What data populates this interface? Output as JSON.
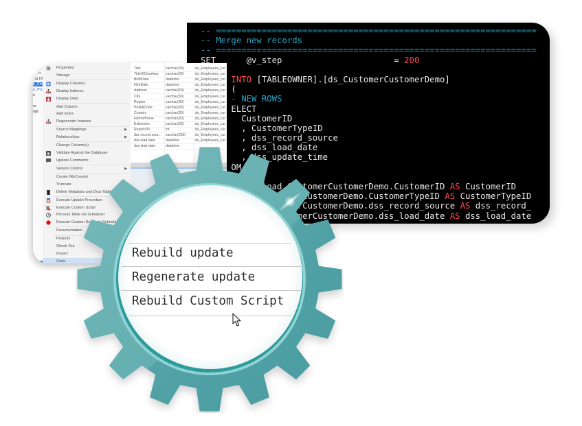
{
  "code_window": {
    "lines": [
      [
        {
          "t": "-- ===============================================================",
          "c": "comment"
        }
      ],
      [
        {
          "t": "-- Merge new records",
          "c": "comment"
        }
      ],
      [
        {
          "t": "-- ===============================================================",
          "c": "comment"
        }
      ],
      [
        {
          "t": "SET      @v_step                      = ",
          "c": "plain"
        },
        {
          "t": "200",
          "c": "num"
        }
      ],
      [
        {
          "t": "",
          "c": "plain"
        }
      ],
      [
        {
          "t": "      ",
          "c": "plain"
        },
        {
          "t": "INTO",
          "c": "kw"
        },
        {
          "t": " [TABLEOWNER].[ds_CustomerCustomerDemo]",
          "c": "plain"
        }
      ],
      [
        {
          "t": "      (",
          "c": "plain"
        }
      ],
      [
        {
          "t": "      ",
          "c": "plain"
        },
        {
          "t": "- NEW ROWS",
          "c": "comment"
        }
      ],
      [
        {
          "t": "      ELECT",
          "c": "plain"
        }
      ],
      [
        {
          "t": "        CustomerID",
          "c": "plain"
        }
      ],
      [
        {
          "t": "        , CustomerTypeID",
          "c": "plain"
        }
      ],
      [
        {
          "t": "        , dss_record_source",
          "c": "plain"
        }
      ],
      [
        {
          "t": "        , dss_load_date",
          "c": "plain"
        }
      ],
      [
        {
          "t": "        , dss_update_time",
          "c": "plain"
        }
      ],
      [
        {
          "t": "      OM",
          "c": "plain"
        }
      ],
      [
        {
          "t": "        (",
          "c": "plain"
        }
      ],
      [
        {
          "t": "            load_CustomerCustomerDemo.CustomerID ",
          "c": "plain"
        },
        {
          "t": "AS",
          "c": "kw"
        },
        {
          "t": " CustomerID",
          "c": "plain"
        }
      ],
      [
        {
          "t": "           _CustomerCustomerDemo.CustomerTypeID ",
          "c": "plain"
        },
        {
          "t": "AS",
          "c": "kw"
        },
        {
          "t": " CustomerTypeID",
          "c": "plain"
        }
      ],
      [
        {
          "t": "            CustomerCustomerDemo.dss_record_source ",
          "c": "plain"
        },
        {
          "t": "AS",
          "c": "kw"
        },
        {
          "t": " dss_record_",
          "c": "plain"
        }
      ],
      [
        {
          "t": "            erCustomerCustomerDemo.dss_load_date ",
          "c": "plain"
        },
        {
          "t": "AS",
          "c": "kw"
        },
        {
          "t": " dss_load_date",
          "c": "plain"
        }
      ]
    ]
  },
  "tree": {
    "items": [
      {
        "label": "ision",
        "style": ""
      },
      {
        "label": "ing Di",
        "style": ""
      },
      {
        "label": "n_Emp",
        "style": "sel"
      },
      {
        "label": "n_Prod",
        "style": "link"
      },
      {
        "label": "e",
        "style": ""
      },
      {
        "label": "",
        "style": ""
      },
      {
        "label": "re",
        "style": ""
      },
      {
        "label": "ript",
        "style": ""
      }
    ]
  },
  "context_menu": {
    "items": [
      {
        "label": "Properties",
        "icon": "gear-icon",
        "submenu": false
      },
      {
        "label": "Storage",
        "icon": "",
        "submenu": false
      },
      {
        "sep": true
      },
      {
        "label": "Display Columns",
        "icon": "columns-icon",
        "submenu": false
      },
      {
        "label": "Display Indexes",
        "icon": "indexes-icon",
        "submenu": false
      },
      {
        "label": "Display Data",
        "icon": "data-chart-icon",
        "submenu": false
      },
      {
        "sep": true
      },
      {
        "label": "Add Column",
        "icon": "",
        "submenu": false
      },
      {
        "label": "Add Index",
        "icon": "",
        "submenu": false
      },
      {
        "label": "Regenerate Indexes",
        "icon": "indexes-icon",
        "submenu": false
      },
      {
        "sep": true
      },
      {
        "label": "Source Mappings",
        "icon": "",
        "submenu": true
      },
      {
        "label": "Relationships",
        "icon": "",
        "submenu": true
      },
      {
        "sep": true
      },
      {
        "label": "Change Column(s)",
        "icon": "",
        "submenu": false
      },
      {
        "label": "Validate Against the Database",
        "icon": "validate-icon",
        "submenu": false
      },
      {
        "label": "Update Comments",
        "icon": "comment-icon",
        "submenu": false
      },
      {
        "sep": true
      },
      {
        "label": "Version Control",
        "icon": "",
        "submenu": true
      },
      {
        "sep": true
      },
      {
        "label": "Create (ReCreate)",
        "icon": "",
        "submenu": false
      },
      {
        "label": "Truncate",
        "icon": "",
        "submenu": false
      },
      {
        "label": "Delete Metadata and Drop Table",
        "icon": "delete-icon",
        "submenu": false
      },
      {
        "sep": true
      },
      {
        "label": "Execute Update Procedure",
        "icon": "execute-update-icon",
        "submenu": false
      },
      {
        "label": "Execute Custom Script",
        "icon": "execute-script-icon",
        "submenu": false
      },
      {
        "label": "Process Table via Scheduler",
        "icon": "clock-icon",
        "submenu": false
      },
      {
        "label": "Execute Custom Script via Scheduler",
        "icon": "red-circle-icon",
        "submenu": false
      },
      {
        "sep": true
      },
      {
        "label": "Documentation",
        "icon": "",
        "submenu": false
      },
      {
        "sep": true
      },
      {
        "label": "Projects",
        "icon": "",
        "submenu": false
      },
      {
        "label": "Check Out",
        "icon": "",
        "submenu": false
      },
      {
        "label": "Impact",
        "icon": "",
        "submenu": false
      },
      {
        "label": "Code",
        "icon": "",
        "submenu": false,
        "highlight": true
      }
    ]
  },
  "columns_grid": {
    "rows": [
      [
        "Title",
        "varchar(30)",
        "ds_Employees_cur"
      ],
      [
        "TitleOfCourtesy",
        "varchar(30)",
        "ds_Employees_cur"
      ],
      [
        "BirthDate",
        "datetime",
        "ds_Employees_cur"
      ],
      [
        "HireDate",
        "datetime",
        "ds_Employees_cur"
      ],
      [
        "Address",
        "varchar(60)",
        "ds_Employees_cur"
      ],
      [
        "City",
        "varchar(30)",
        "ds_Employees_cur"
      ],
      [
        "Region",
        "varchar(30)",
        "ds_Employees_cur"
      ],
      [
        "PostalCode",
        "varchar(30)",
        "ds_Employees_cur"
      ],
      [
        "Country",
        "varchar(30)",
        "ds_Employees_cur"
      ],
      [
        "HomePhone",
        "varchar(30)",
        "ds_Employees_cur"
      ],
      [
        "Extension",
        "varchar(30)",
        "ds_Employees_cur"
      ],
      [
        "ReportsTo",
        "int",
        "ds_Employees_cur"
      ],
      [
        "dss record sour...",
        "varchar(255)",
        "ds_Employees_cur"
      ],
      [
        "dss load date",
        "datetime",
        "ds_Employees_cur"
      ],
      [
        "dss start date",
        "datetime",
        ""
      ]
    ]
  },
  "lens_menu": {
    "items": [
      "Rebuild update",
      "Regenerate update",
      "Rebuild Custom Script"
    ]
  },
  "colors": {
    "gear": "#55a8ab",
    "gear_light": "#74b7b9",
    "gear_ring": "#8fd3d3",
    "code_bg": "#000000",
    "code_comment": "#2aa3c4",
    "code_keyword": "#ff4a4a",
    "menu_highlight": "#cfe0f4",
    "selection_blue": "#2a6fd6"
  }
}
